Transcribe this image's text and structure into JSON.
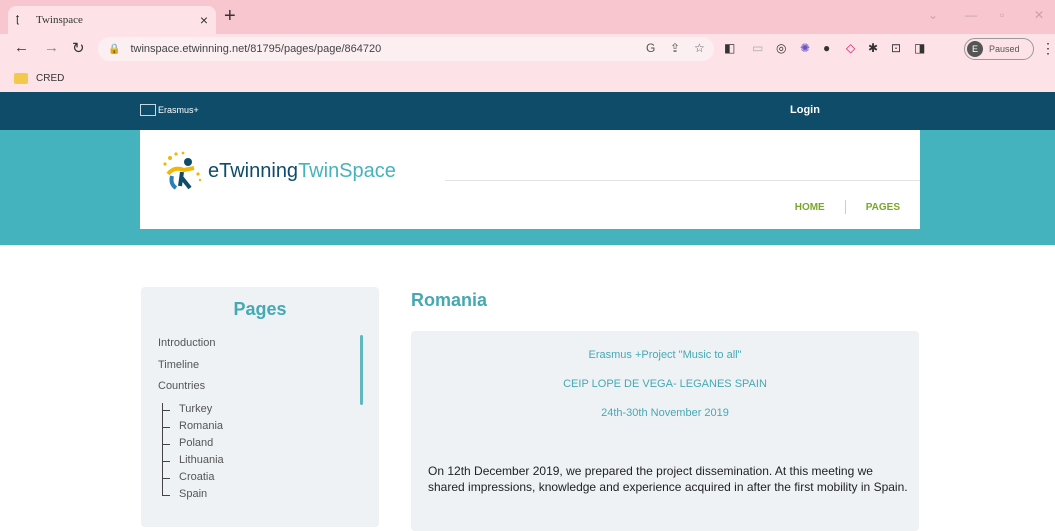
{
  "browser": {
    "tab_title": "Twinspace",
    "tab_favicon": "tw-favicon",
    "url": "twinspace.etwinning.net/81795/pages/page/864720",
    "profile_initial": "E",
    "profile_status": "Paused",
    "bookmark": "CRED"
  },
  "site": {
    "erasmus_label": "Erasmus+",
    "login_label": "Login",
    "logo": {
      "part1": "eTwinning",
      "part2": "TwinSpace"
    },
    "nav": {
      "home": "HOME",
      "pages": "PAGES"
    }
  },
  "sidebar": {
    "heading": "Pages",
    "items": [
      "Introduction",
      "Timeline",
      "Countries"
    ],
    "countries": [
      "Turkey",
      "Romania",
      "Poland",
      "Lithuania",
      "Croatia",
      "Spain"
    ]
  },
  "main": {
    "title": "Romania",
    "line1": "Erasmus +Project \"Music to all\"",
    "line2": "CEIP LOPE DE VEGA- LEGANES SPAIN",
    "line3": "24th-30th November 2019",
    "paragraph": "On 12th December 2019, we prepared the project dissemination. At this meeting we shared impressions, knowledge and experience acquired in after the first mobility in Spain."
  },
  "colors": {
    "topbar": "#0f4c6a",
    "banner": "#45b3bd",
    "accent": "#45a9b4",
    "nav_green": "#7aa62b"
  }
}
